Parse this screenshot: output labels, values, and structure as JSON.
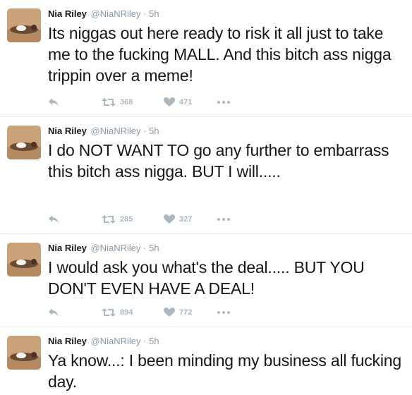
{
  "colors": {
    "secondary_text": "#8899a6",
    "action_icon": "#aab8c2",
    "divider": "#e1e8ed",
    "primary_text": "#14171a"
  },
  "icons": {
    "reply": "reply-arrow-icon",
    "retweet": "retweet-icon",
    "like": "heart-icon",
    "more": "ellipsis-icon"
  },
  "tweets": [
    {
      "fullname": "Nia Riley",
      "username": "@NiaNRiley",
      "separator": "·",
      "time": "5h",
      "text": "Its niggas out here ready to risk it all just to take me to the fucking MALL. And this bitch ass nigga trippin over a meme!",
      "retweets": "368",
      "likes": "471"
    },
    {
      "fullname": "Nia Riley",
      "username": "@NiaNRiley",
      "separator": "·",
      "time": "5h",
      "text": "I do NOT WANT TO go any further to embarrass this bitch ass nigga. BUT I will.....",
      "retweets": "285",
      "likes": "327"
    },
    {
      "fullname": "Nia Riley",
      "username": "@NiaNRiley",
      "separator": "·",
      "time": "5h",
      "text": "I would ask you what's the deal..... BUT YOU DON'T EVEN HAVE A DEAL!",
      "retweets": "894",
      "likes": "772"
    },
    {
      "fullname": "Nia Riley",
      "username": "@NiaNRiley",
      "separator": "·",
      "time": "5h",
      "text": "Ya know...: I been minding my business all fucking day.",
      "retweets": "",
      "likes": ""
    }
  ]
}
